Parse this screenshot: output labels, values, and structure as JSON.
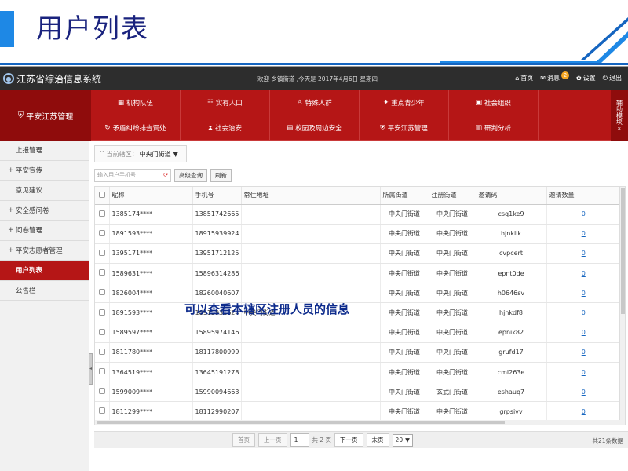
{
  "slide": {
    "title": "用户列表",
    "overlay": "可以查看本辖区注册人员的信息"
  },
  "header": {
    "app_name": "江苏省综治信息系统",
    "welcome": "欢迎 乡镇街道 ,今天是 2017年4月6日 星期四",
    "links": {
      "home": "首页",
      "messages": "消息",
      "message_badge": "2",
      "settings": "设置",
      "logout": "退出"
    }
  },
  "nav": {
    "brand": "平安江苏管理",
    "side_label": "辅助模块 »",
    "row1": [
      "机构队伍",
      "实有人口",
      "特殊人群",
      "重点青少年",
      "社会组织",
      ""
    ],
    "row2": [
      "矛盾纠纷排查调处",
      "社会治安",
      "校园及周边安全",
      "平安江苏管理",
      "研判分析",
      ""
    ]
  },
  "sidebar": {
    "items": [
      {
        "label": "上报管理",
        "plus": ""
      },
      {
        "label": "平安宣传",
        "plus": "+"
      },
      {
        "label": "意见建议",
        "plus": ""
      },
      {
        "label": "安全感问卷",
        "plus": "+"
      },
      {
        "label": "问卷管理",
        "plus": "+"
      },
      {
        "label": "平安志愿者管理",
        "plus": "+"
      },
      {
        "label": "用户列表",
        "plus": ""
      },
      {
        "label": "公告栏",
        "plus": ""
      }
    ]
  },
  "main": {
    "crumb_prefix": "当前辖区：",
    "crumb_value": "中央门街道",
    "search_placeholder": "输入用户手机号",
    "advanced_search": "高级查询",
    "refresh": "刷新",
    "columns": [
      "昵称",
      "手机号",
      "常住地址",
      "所属街道",
      "注册街道",
      "邀请码",
      "邀请数量"
    ],
    "rows": [
      [
        "1385174****",
        "13851742665",
        "",
        "中央门街道",
        "中央门街道",
        "csq1ke9",
        "0"
      ],
      [
        "1891593****",
        "18915939924",
        "",
        "中央门街道",
        "中央门街道",
        "hjnklik",
        "0"
      ],
      [
        "1395171****",
        "13951712125",
        "",
        "中央门街道",
        "中央门街道",
        "cvpcert",
        "0"
      ],
      [
        "1589631****",
        "15896314286",
        "",
        "中央门街道",
        "中央门街道",
        "epnt0de",
        "0"
      ],
      [
        "1826004****",
        "18260040607",
        "",
        "中央门街道",
        "中央门街道",
        "h0646sv",
        "0"
      ],
      [
        "1891593****",
        "18915931624",
        "中央门街道",
        "中央门街道",
        "中央门街道",
        "hjnkdf8",
        "0"
      ],
      [
        "1589597****",
        "15895974146",
        "",
        "中央门街道",
        "中央门街道",
        "epnik82",
        "0"
      ],
      [
        "1811780****",
        "18117800999",
        "",
        "中央门街道",
        "中央门街道",
        "grufd17",
        "0"
      ],
      [
        "1364519****",
        "13645191278",
        "",
        "中央门街道",
        "中央门街道",
        "cml263e",
        "0"
      ],
      [
        "1599009****",
        "15990094663",
        "",
        "中央门街道",
        "玄武门街道",
        "eshauq7",
        "0"
      ],
      [
        "1811299****",
        "18112990207",
        "",
        "中央门街道",
        "中央门街道",
        "grpsivv",
        "0"
      ]
    ]
  },
  "pager": {
    "first": "首页",
    "prev": "上一页",
    "page": "1",
    "pages_text": "共 2 页",
    "next": "下一页",
    "last": "末页",
    "page_size": "20",
    "total": "共21条数据"
  }
}
